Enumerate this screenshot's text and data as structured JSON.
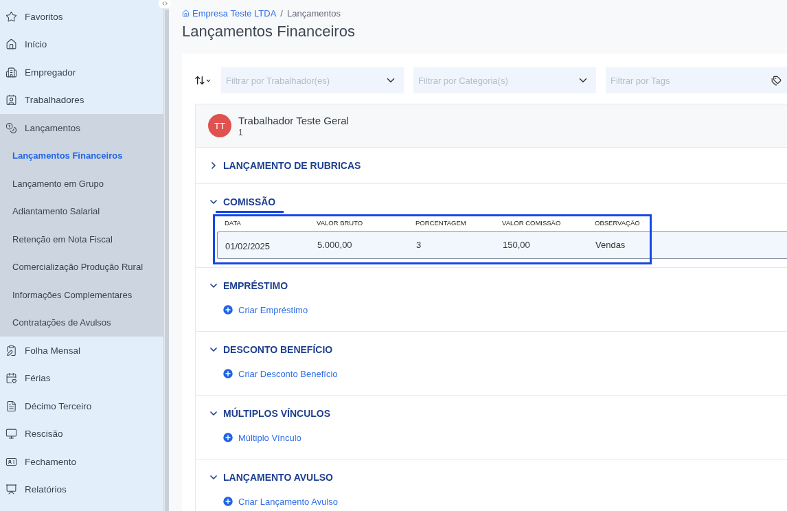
{
  "sidebar": {
    "items": [
      {
        "kind": "item",
        "label": "Favoritos",
        "selected": false
      },
      {
        "kind": "item",
        "label": "Início",
        "selected": false
      },
      {
        "kind": "item",
        "label": "Empregador",
        "selected": false
      },
      {
        "kind": "item",
        "label": "Trabalhadores",
        "selected": false
      },
      {
        "kind": "group",
        "label": "Lançamentos",
        "expanded": true,
        "children": [
          {
            "label": "Lançamentos Financeiros",
            "selected": true
          },
          {
            "label": "Lançamento em Grupo",
            "selected": false
          },
          {
            "label": "Adiantamento Salarial",
            "selected": false
          },
          {
            "label": "Retenção em Nota Fiscal",
            "selected": false
          },
          {
            "label": "Comercialização Produção Rural",
            "selected": false
          },
          {
            "label": "Informações Complementares",
            "selected": false
          },
          {
            "label": "Contratações de Avulsos",
            "selected": false
          }
        ]
      },
      {
        "kind": "item",
        "label": "Folha Mensal",
        "selected": false
      },
      {
        "kind": "item",
        "label": "Férias",
        "selected": false
      },
      {
        "kind": "item",
        "label": "Décimo Terceiro",
        "selected": false
      },
      {
        "kind": "item",
        "label": "Rescisão",
        "selected": false
      },
      {
        "kind": "item",
        "label": "Fechamento",
        "selected": false
      },
      {
        "kind": "item",
        "label": "Relatórios",
        "selected": false
      }
    ]
  },
  "breadcrumb": {
    "items": [
      "Empresa Teste LTDA",
      "Lançamentos"
    ],
    "separator": "/"
  },
  "page_title": "Lançamentos Financeiros",
  "filters": [
    {
      "placeholder": "Filtrar por Trabalhador(es)",
      "kind": "select"
    },
    {
      "placeholder": "Filtrar por Categoria(s)",
      "kind": "select"
    },
    {
      "placeholder": "Filtrar por Tags",
      "kind": "tags"
    }
  ],
  "worker": {
    "initials": "TT",
    "name": "Trabalhador Teste Geral",
    "subtitle": "1"
  },
  "sections": [
    {
      "title": "LANÇAMENTO DE RUBRICAS",
      "expanded": false,
      "highlighted": false
    },
    {
      "kind": "table",
      "title": "COMISSÃO",
      "expanded": true,
      "highlighted": true,
      "columns": [
        "DATA",
        "VALOR BRUTO",
        "PORCENTAGEM",
        "VALOR COMISSÃO",
        "OBSERVAÇÃO"
      ],
      "rows": [
        [
          "01/02/2025",
          "5.000,00",
          "3",
          "150,00",
          "Vendas"
        ]
      ]
    },
    {
      "kind": "link",
      "title": "EMPRÉSTIMO",
      "expanded": true,
      "highlighted": false,
      "link": "Criar Empréstimo"
    },
    {
      "kind": "link",
      "title": "DESCONTO BENEFÍCIO",
      "expanded": true,
      "highlighted": false,
      "link": "Criar Desconto Benefício"
    },
    {
      "kind": "link",
      "title": "MÚLTIPLOS VÍNCULOS",
      "expanded": true,
      "highlighted": false,
      "link": "Múltiplo Vínculo"
    },
    {
      "kind": "link",
      "title": "LANÇAMENTO AVULSO",
      "expanded": true,
      "highlighted": false,
      "link": "Criar Lançamento Avulso"
    }
  ]
}
